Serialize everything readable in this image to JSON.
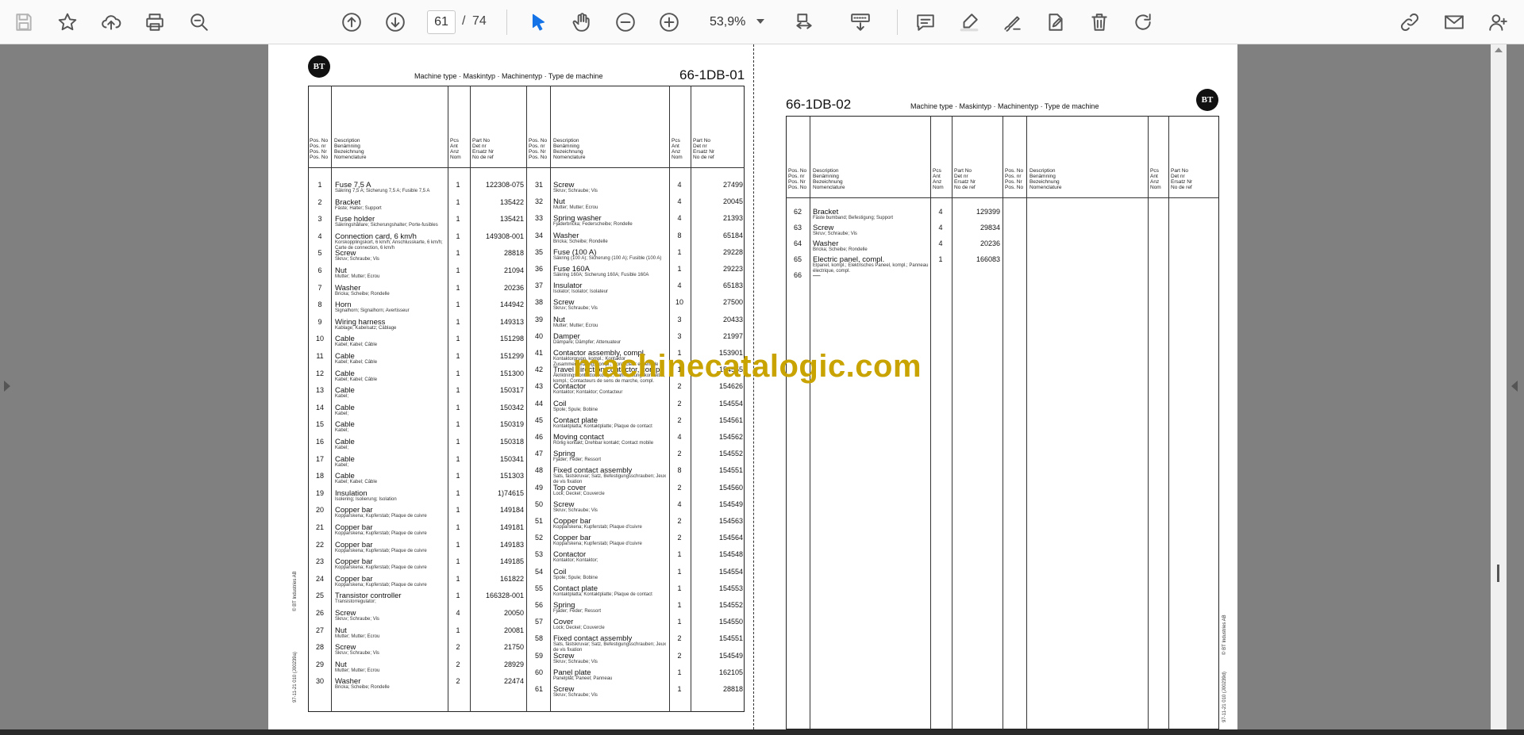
{
  "toolbar": {
    "icons": [
      "save-icon",
      "star-icon",
      "upload-icon",
      "print-icon",
      "zoom-search-icon",
      "page-up-icon",
      "page-down-icon",
      "select-arrow-icon",
      "hand-icon",
      "zoom-out-icon",
      "zoom-in-icon",
      "fit-page-icon",
      "scroll-mode-icon",
      "comment-icon",
      "highlight-icon",
      "sign-icon",
      "edit-pdf-icon",
      "delete-icon",
      "rotate-icon",
      "share-link-icon",
      "mail-icon",
      "add-user-icon"
    ],
    "current_page": "61",
    "page_separator": "/",
    "total_pages": "74",
    "zoom": "53,9%"
  },
  "colors": {
    "toolbar_bg": "#fafafa",
    "viewer_bg": "#808080",
    "watermark": "#c9a400",
    "accent": "#1473e6"
  },
  "watermark": "machinecatalogic.com",
  "page1": {
    "logo": "BT",
    "machine_type": "Machine type · Maskintyp · Machinentyp · Type de machine",
    "code": "66-1DB-01",
    "side_note": "© BT Industries AB",
    "side_date": "97-11-21   010   (J00239a)",
    "header_pos": "Pos. No\nPos. nr\nPos. Nr\nPos. No",
    "header_desc": "Description\nBenämning\nBezeichnung\nNomenclature",
    "header_qty": "Pcs\nAnt\nAnz\nNom",
    "header_part": "Part No\nDet nr\nErsatz Nr\nNo de ref",
    "left_rows": [
      {
        "pos": "1",
        "desc": "Fuse 7,5 A",
        "sub": "Säkring 7,5 A; Sicherung 7,5 A; Fusible 7,5 A",
        "qty": "1",
        "part": "122308-075"
      },
      {
        "pos": "2",
        "desc": "Bracket",
        "sub": "Fäste; Halter; Support",
        "qty": "1",
        "part": "135422"
      },
      {
        "pos": "3",
        "desc": "Fuse holder",
        "sub": "Säkringshållare; Sicherungshalter; Porte-fusibles",
        "qty": "1",
        "part": "135421"
      },
      {
        "pos": "4",
        "desc": "Connection card, 6 km/h",
        "sub": "Korskopplingskort, 6 km/h; Anschlusskarte, 6 km/h; Carte de connection, 6 km/h",
        "qty": "1",
        "part": "149308-001"
      },
      {
        "pos": "5",
        "desc": "Screw",
        "sub": "Skruv; Schraube; Vis",
        "qty": "1",
        "part": "28818"
      },
      {
        "pos": "6",
        "desc": "Nut",
        "sub": "Mutter; Mutter; Ecrou",
        "qty": "1",
        "part": "21094"
      },
      {
        "pos": "7",
        "desc": "Washer",
        "sub": "Bricka; Scheibe; Rondelle",
        "qty": "1",
        "part": "20236"
      },
      {
        "pos": "8",
        "desc": "Horn",
        "sub": "Signalhorn; Signalhorn; Avertisseur",
        "qty": "1",
        "part": "144942"
      },
      {
        "pos": "9",
        "desc": "Wiring harness",
        "sub": "Kablage; Kabelsatz; Câblage",
        "qty": "1",
        "part": "149313"
      },
      {
        "pos": "10",
        "desc": "Cable",
        "sub": "Kabel; Kabel; Câble",
        "qty": "1",
        "part": "151298"
      },
      {
        "pos": "11",
        "desc": "Cable",
        "sub": "Kabel; Kabel; Câble",
        "qty": "1",
        "part": "151299"
      },
      {
        "pos": "12",
        "desc": "Cable",
        "sub": "Kabel; Kabel; Câble",
        "qty": "1",
        "part": "151300"
      },
      {
        "pos": "13",
        "desc": "Cable",
        "sub": "Kabel;",
        "qty": "1",
        "part": "150317"
      },
      {
        "pos": "14",
        "desc": "Cable",
        "sub": "Kabel;",
        "qty": "1",
        "part": "150342"
      },
      {
        "pos": "15",
        "desc": "Cable",
        "sub": "Kabel;",
        "qty": "1",
        "part": "150319"
      },
      {
        "pos": "16",
        "desc": "Cable",
        "sub": "Kabel;",
        "qty": "1",
        "part": "150318"
      },
      {
        "pos": "17",
        "desc": "Cable",
        "sub": "Kabel;",
        "qty": "1",
        "part": "150341"
      },
      {
        "pos": "18",
        "desc": "Cable",
        "sub": "Kabel; Kabel; Câble",
        "qty": "1",
        "part": "151303"
      },
      {
        "pos": "19",
        "desc": "Insulation",
        "sub": "Isolering; Isolierung; Isolation",
        "qty": "1",
        "part": "1)74615"
      },
      {
        "pos": "20",
        "desc": "Copper bar",
        "sub": "Kopparskena; Kupferstab; Plaque de cuivre",
        "qty": "1",
        "part": "149184"
      },
      {
        "pos": "21",
        "desc": "Copper bar",
        "sub": "Kopparskena; Kupferstab; Plaque de cuivre",
        "qty": "1",
        "part": "149181"
      },
      {
        "pos": "22",
        "desc": "Copper bar",
        "sub": "Kopparskena; Kupferstab; Plaque de cuivre",
        "qty": "1",
        "part": "149183"
      },
      {
        "pos": "23",
        "desc": "Copper bar",
        "sub": "Kopparskena; Kupferstab; Plaque de cuivre",
        "qty": "1",
        "part": "149185"
      },
      {
        "pos": "24",
        "desc": "Copper bar",
        "sub": "Kopparskena; Kupferstab; Plaque de cuivre",
        "qty": "1",
        "part": "161822"
      },
      {
        "pos": "25",
        "desc": "Transistor controller",
        "sub": "Transistorregulator;",
        "qty": "1",
        "part": "166328-001"
      },
      {
        "pos": "26",
        "desc": "Screw",
        "sub": "Skruv; Schraube; Vis",
        "qty": "4",
        "part": "20050"
      },
      {
        "pos": "27",
        "desc": "Nut",
        "sub": "Mutter; Mutter; Ecrou",
        "qty": "1",
        "part": "20081"
      },
      {
        "pos": "28",
        "desc": "Screw",
        "sub": "Skruv; Schraube; Vis",
        "qty": "2",
        "part": "21750"
      },
      {
        "pos": "29",
        "desc": "Nut",
        "sub": "Mutter; Mutter; Ecrou",
        "qty": "2",
        "part": "28929"
      },
      {
        "pos": "30",
        "desc": "Washer",
        "sub": "Bricka; Scheibe; Rondelle",
        "qty": "2",
        "part": "22474"
      }
    ],
    "right_rows": [
      {
        "pos": "31",
        "desc": "Screw",
        "sub": "Skruv; Schraube; Vis",
        "qty": "4",
        "part": "27499"
      },
      {
        "pos": "32",
        "desc": "Nut",
        "sub": "Mutter; Mutter; Ecrou",
        "qty": "4",
        "part": "20045"
      },
      {
        "pos": "33",
        "desc": "Spring washer",
        "sub": "Fjäderbricka; Federscheibe; Rondelle",
        "qty": "4",
        "part": "21393"
      },
      {
        "pos": "34",
        "desc": "Washer",
        "sub": "Bricka; Scheibe; Rondelle",
        "qty": "8",
        "part": "65184"
      },
      {
        "pos": "35",
        "desc": "Fuse (100 A)",
        "sub": "Säkring (100 A); Sicherung (100 A); Fusible (100 A)",
        "qty": "1",
        "part": "29228"
      },
      {
        "pos": "36",
        "desc": "Fuse 160A",
        "sub": "Säkring 160A; Sicherung 160A; Fusible 160A",
        "qty": "1",
        "part": "29223"
      },
      {
        "pos": "37",
        "desc": "Insulator",
        "sub": "Isolator; Isolator; Isolateur",
        "qty": "4",
        "part": "65183"
      },
      {
        "pos": "38",
        "desc": "Screw",
        "sub": "Skruv; Schraube; Vis",
        "qty": "10",
        "part": "27500"
      },
      {
        "pos": "39",
        "desc": "Nut",
        "sub": "Mutter; Mutter; Ecrou",
        "qty": "3",
        "part": "20433"
      },
      {
        "pos": "40",
        "desc": "Damper",
        "sub": "Dämpare; Dämpfer; Attenuateur",
        "qty": "3",
        "part": "21997"
      },
      {
        "pos": "41",
        "desc": "Contactor assembly, compl.",
        "sub": "Kontaktorgrupp, kompl.; Kontaktor Zusammensetzung, kompl.; Contacteur ensemble",
        "qty": "1",
        "part": "153901"
      },
      {
        "pos": "42",
        "desc": "Travel direction contactor, compl.",
        "sub": "Åkriktningskontaktor, kompl.; Fahrrichtungskontaktor, kompl.; Contacteurs de sens de marche, compl.",
        "qty": "1",
        "part": "154555"
      },
      {
        "pos": "43",
        "desc": "Contactor",
        "sub": "Kontaktor; Kontaktor; Contacteur",
        "qty": "2",
        "part": "154626"
      },
      {
        "pos": "44",
        "desc": "Coil",
        "sub": "Spole; Spule; Bobine",
        "qty": "2",
        "part": "154554"
      },
      {
        "pos": "45",
        "desc": "Contact plate",
        "sub": "Kontaktplatta; Kontaktplatte; Plaque de contact",
        "qty": "2",
        "part": "154561"
      },
      {
        "pos": "46",
        "desc": "Moving contact",
        "sub": "Rörlig kontakt; Drehbar kontakt; Contact mobile",
        "qty": "4",
        "part": "154562"
      },
      {
        "pos": "47",
        "desc": "Spring",
        "sub": "Fjäder; Feder; Ressort",
        "qty": "2",
        "part": "154552"
      },
      {
        "pos": "48",
        "desc": "Fixed contact assembly",
        "sub": "Sats, fästskruvar; Satz, Befestigungsschrauben; Jeux de vis fixation",
        "qty": "8",
        "part": "154551"
      },
      {
        "pos": "49",
        "desc": "Top cover",
        "sub": "Lock; Deckel; Couvercle",
        "qty": "2",
        "part": "154560"
      },
      {
        "pos": "50",
        "desc": "Screw",
        "sub": "Skruv; Schraube; Vis",
        "qty": "4",
        "part": "154549"
      },
      {
        "pos": "51",
        "desc": "Copper bar",
        "sub": "Kopparskena; Kupferstab; Plaque d'cuivre",
        "qty": "2",
        "part": "154563"
      },
      {
        "pos": "52",
        "desc": "Copper bar",
        "sub": "Kopparskena; Kupferstab; Plaque d'cuivre",
        "qty": "2",
        "part": "154564"
      },
      {
        "pos": "53",
        "desc": "Contactor",
        "sub": "Kontaktor; Kontaktor;",
        "qty": "1",
        "part": "154548"
      },
      {
        "pos": "54",
        "desc": "Coil",
        "sub": "Spole; Spule; Bobine",
        "qty": "1",
        "part": "154554"
      },
      {
        "pos": "55",
        "desc": "Contact plate",
        "sub": "Kontaktplatta; Kontaktplatte; Plaque de contact",
        "qty": "1",
        "part": "154553"
      },
      {
        "pos": "56",
        "desc": "Spring",
        "sub": "Fjäder; Feder; Ressort",
        "qty": "1",
        "part": "154552"
      },
      {
        "pos": "57",
        "desc": "Cover",
        "sub": "Lock; Deckel; Couvercle",
        "qty": "1",
        "part": "154550"
      },
      {
        "pos": "58",
        "desc": "Fixed contact assembly",
        "sub": "Sats, fästskruvar; Satz, Befestigungsschrauben; Jeux de vis fixation",
        "qty": "2",
        "part": "154551"
      },
      {
        "pos": "59",
        "desc": "Screw",
        "sub": "Skruv; Schraube; Vis",
        "qty": "2",
        "part": "154549"
      },
      {
        "pos": "60",
        "desc": "Panel plate",
        "sub": "Panelplåt; Paneel; Panneau",
        "qty": "1",
        "part": "162105"
      },
      {
        "pos": "61",
        "desc": "Screw",
        "sub": "Skruv; Schraube; Vis",
        "qty": "1",
        "part": "28818"
      }
    ]
  },
  "page2": {
    "logo": "BT",
    "machine_type": "Machine type · Maskintyp · Machinentyp · Type de machine",
    "code": "66-1DB-02",
    "side_note": "© BT Industries AB",
    "side_date": "97-11-21   010   (J00239d)",
    "rows": [
      {
        "pos": "62",
        "desc": "Bracket",
        "sub": "Fäste bumband; Befestigung; Support",
        "qty": "4",
        "part": "129399"
      },
      {
        "pos": "63",
        "desc": "Screw",
        "sub": "Skruv; Schraube; Vis",
        "qty": "4",
        "part": "29834"
      },
      {
        "pos": "64",
        "desc": "Washer",
        "sub": "Bricka; Scheibe; Rondelle",
        "qty": "4",
        "part": "20236"
      },
      {
        "pos": "65",
        "desc": "Electric panel, compl.",
        "sub": "Elpanel, kompl.; Elektrisches Paneel, kompl.; Panneau électrique, compl.",
        "qty": "1",
        "part": "166083"
      },
      {
        "pos": "66",
        "desc": "—",
        "sub": "",
        "qty": "",
        "part": ""
      }
    ]
  }
}
